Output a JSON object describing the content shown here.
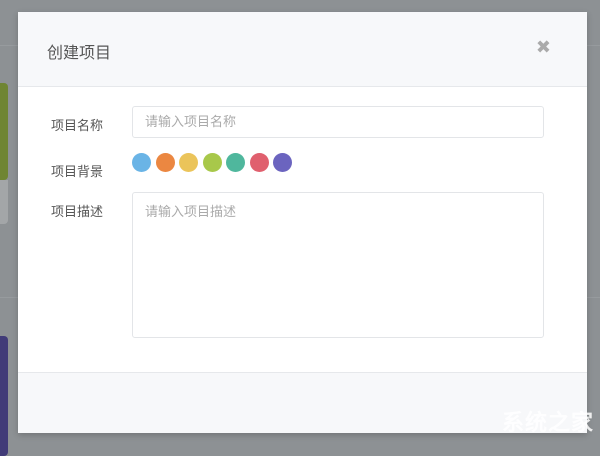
{
  "modal": {
    "title": "创建项目",
    "close_icon": "close-icon",
    "fields": {
      "name": {
        "label": "项目名称",
        "placeholder": "请输入项目名称",
        "value": ""
      },
      "background": {
        "label": "项目背景",
        "colors": [
          "#6ab4e6",
          "#eb8741",
          "#ebc45a",
          "#a8c84a",
          "#4fb79d",
          "#e0606e",
          "#6b64bf"
        ]
      },
      "description": {
        "label": "项目描述",
        "placeholder": "请输入项目描述",
        "value": ""
      }
    }
  },
  "watermark": "系统之家"
}
